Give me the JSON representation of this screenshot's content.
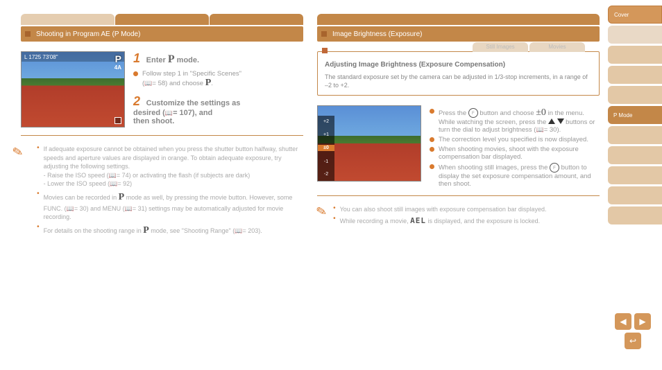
{
  "left": {
    "tabs": [
      "",
      "",
      ""
    ],
    "header": "Shooting in Program AE (P Mode)",
    "lcd": {
      "top": "L  1725  73'08\"",
      "mode": "P",
      "flash": "4A"
    },
    "step1_title_prefix": "Enter ",
    "step1_title_mode": "P",
    "step1_title_suffix": " mode.",
    "step1_bullet": "Follow step 1 in \"Specific Scenes\"",
    "step1_ref_prefix": "(",
    "step1_ref_page": "= 58",
    "step1_ref_mid": ") and choose ",
    "step1_ref_suffix": ".",
    "step2_prefix": "Customize the settings as",
    "step2_mid": "desired (",
    "step2_pages": "= 107",
    "step2_suffix": "), and",
    "step2_end": "then shoot.",
    "note1_a": "If adequate exposure cannot be obtained when you press the shutter button halfway, shutter speeds and aperture values are displayed in orange. To obtain adequate exposure, try adjusting the following settings.",
    "note1_b": " - Raise the ISO speed (",
    "note1_b_page": "= 74",
    "note1_b_end": ") or activating the flash (if subjects",
    "note1_c": "are dark)",
    "note1_d": "- Lower the ISO speed (",
    "note1_d_page": "= 92",
    "note1_d_end": ")",
    "note2": "Movies can be recorded in ",
    "note2_mode": "P",
    "note2_end": " mode as well, by pressing the movie button. However, some FUNC. (",
    "note2_ref1": "= 30",
    "note2_mid": ") and MENU (",
    "note2_ref2": "= 31",
    "note2_end2": ") settings may be automatically adjusted for movie recording.",
    "note3_pre": "For details on the shooting range in ",
    "note3_mode": "P",
    "note3_mid": " mode, see \"Shooting Range\"",
    "note3_ref": "= 203",
    "note3_end": "."
  },
  "right": {
    "tabs": [
      "",
      "",
      ""
    ],
    "header": "Image Brightness (Exposure)",
    "box": {
      "subtabs": [
        "Still Images",
        "Movies"
      ],
      "title": "Adjusting Image Brightness (Exposure Compensation)",
      "desc": "The standard exposure set by the camera can be adjusted in 1/3-stop increments, in a range of –2 to +2."
    },
    "lcd_ev": [
      "+2",
      "+1",
      "±0",
      "-1",
      "-2"
    ],
    "step_a1": "Press the ",
    "step_a_icon": "FUNC SET",
    "step_a2": " button and choose ",
    "step_a_ev": "±0",
    "step_a3": " in the menu. While watching the screen, press the ",
    "step_a4": " buttons or turn the ",
    "step_a5": " dial to adjust brightness (",
    "step_a_ref": "= 30",
    "step_a6": ").",
    "step_b": "The correction level you specified is now displayed.",
    "step_c1": "When shooting movies, shoot with the exposure compensation bar displayed.",
    "step_d1": "When shooting still images, press the ",
    "step_d_icon": "FUNC SET",
    "step_d2": " button to display the set exposure compensation amount, and then shoot.",
    "note1": "You can also shoot still images with exposure compensation bar displayed.",
    "note2a": "While recording a movie, ",
    "note2_ael": "AEL",
    "note2b": " is displayed, and the exposure is locked."
  },
  "sidebar": {
    "items": [
      "Cover",
      "",
      "",
      "",
      "",
      "P Mode",
      "",
      "",
      "",
      "",
      ""
    ]
  },
  "nav": {
    "prev": "◀",
    "next": "▶",
    "back": "↩"
  }
}
